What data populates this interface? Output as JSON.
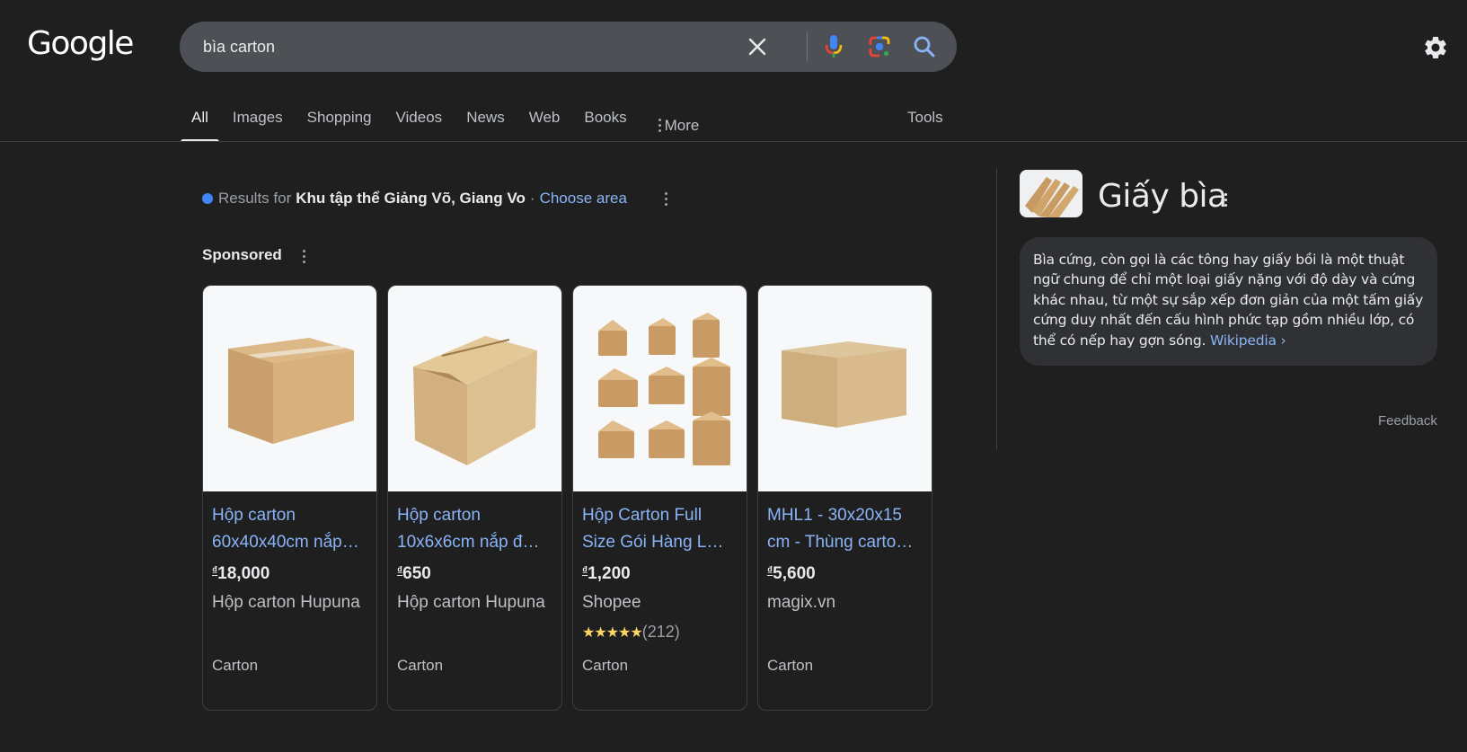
{
  "header": {
    "logo": "Google",
    "search_value": "bìa carton",
    "icons": [
      "clear-icon",
      "mic-icon",
      "lens-icon",
      "search-icon",
      "gear-icon"
    ]
  },
  "tabs": [
    {
      "label": "All",
      "active": true
    },
    {
      "label": "Images"
    },
    {
      "label": "Shopping"
    },
    {
      "label": "Videos"
    },
    {
      "label": "News"
    },
    {
      "label": "Web"
    },
    {
      "label": "Books"
    }
  ],
  "more_label": "More",
  "tools_label": "Tools",
  "location": {
    "prefix": "Results for",
    "place": "Khu tập thể Giảng Võ, Giang Vo",
    "separator": "·",
    "link": "Choose area"
  },
  "sponsored_label": "Sponsored",
  "products": [
    {
      "title_line1": "Hộp carton",
      "title_line2": "60x40x40cm nắp…",
      "currency": "₫",
      "price": "18,000",
      "merchant": "Hộp carton Hupuna",
      "rating_stars": "",
      "rating_count": "",
      "category": "Carton"
    },
    {
      "title_line1": "Hộp carton",
      "title_line2": "10x6x6cm nắp đ…",
      "currency": "₫",
      "price": "650",
      "merchant": "Hộp carton Hupuna",
      "rating_stars": "",
      "rating_count": "",
      "category": "Carton"
    },
    {
      "title_line1": "Hộp Carton Full",
      "title_line2": "Size Gói Hàng L…",
      "currency": "₫",
      "price": "1,200",
      "merchant": "Shopee",
      "rating_stars": "★★★★★",
      "rating_count": "(212)",
      "category": "Carton"
    },
    {
      "title_line1": "MHL1 - 30x20x15",
      "title_line2": "cm - Thùng carto…",
      "currency": "₫",
      "price": "5,600",
      "merchant": "magix.vn",
      "rating_stars": "",
      "rating_count": "",
      "category": "Carton"
    }
  ],
  "knowledge_panel": {
    "title": "Giấy bìa",
    "description": "Bìa cứng, còn gọi là các tông hay giấy bồi là một thuật ngữ chung để chỉ một loại giấy nặng với độ dày và cứng khác nhau, từ một sự sắp xếp đơn giản của một tấm giấy cứng duy nhất đến cấu hình phức tạp gồm nhiều lớp, có thể có nếp hay gợn sóng.",
    "source_link": "Wikipedia ›",
    "feedback": "Feedback"
  },
  "colors": {
    "background": "#1f1f1f",
    "search_box": "#4d5156",
    "link": "#8ab4f8",
    "star": "#fdd663",
    "location_dot": "#4285f4"
  }
}
